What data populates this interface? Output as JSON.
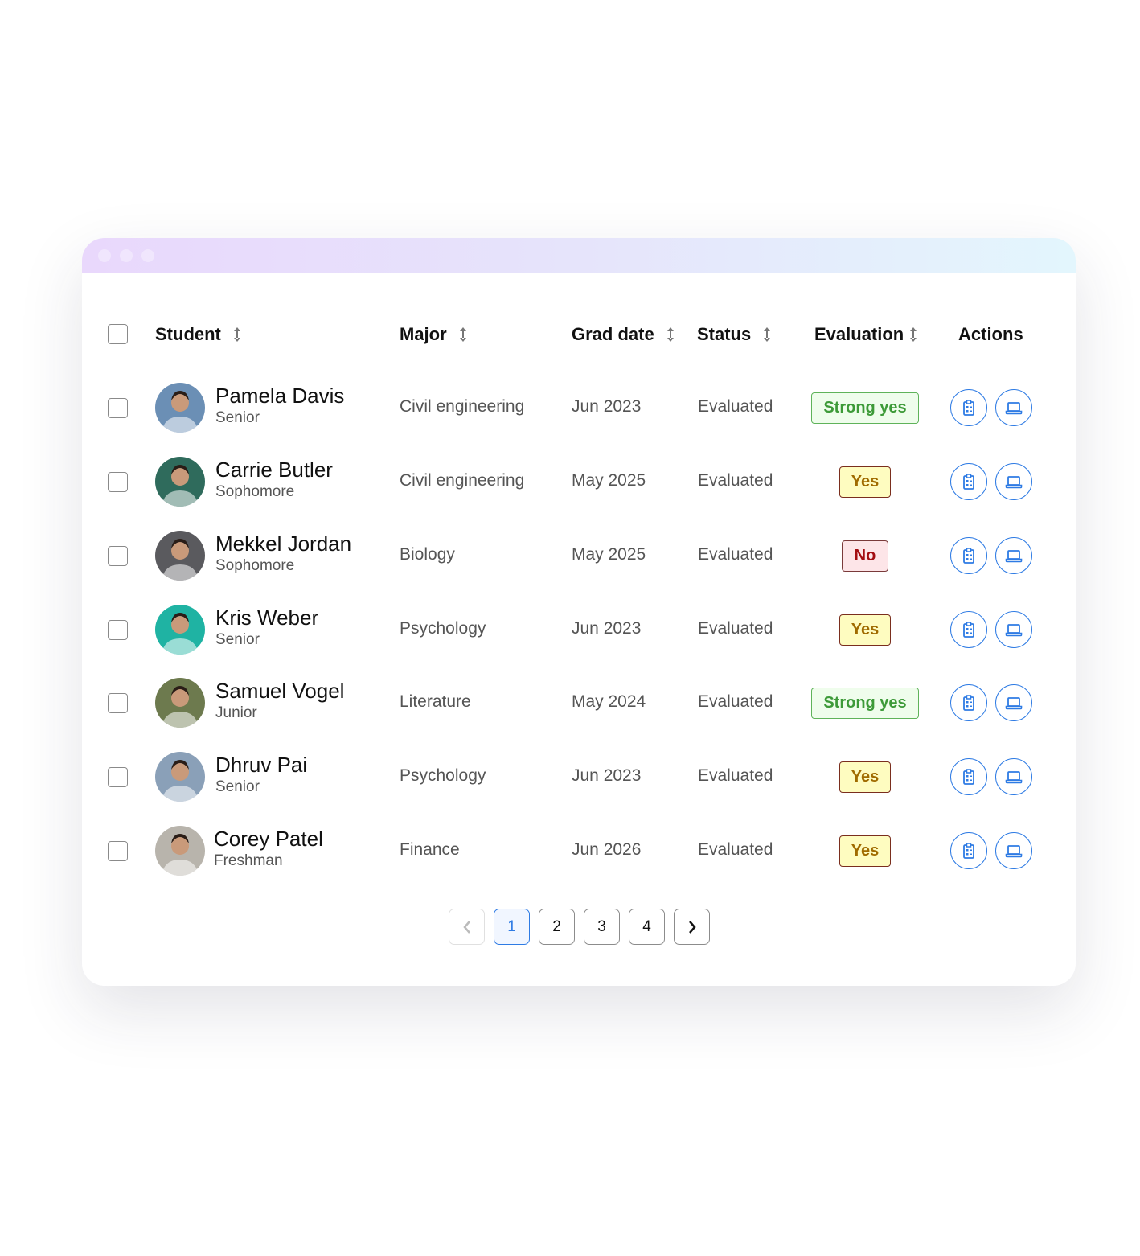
{
  "table": {
    "headers": {
      "student": "Student",
      "major": "Major",
      "grad_date": "Grad date",
      "status": "Status",
      "evaluation": "Evaluation",
      "actions": "Actions"
    },
    "rows": [
      {
        "name": "Pamela Davis",
        "level": "Senior",
        "major": "Civil engineering",
        "grad": "Jun 2023",
        "status": "Evaluated",
        "evaluation": "Strong yes",
        "eval_type": "strong",
        "avatar_color": "#6b8fb5"
      },
      {
        "name": "Carrie Butler",
        "level": "Sophomore",
        "major": "Civil engineering",
        "grad": "May 2025",
        "status": "Evaluated",
        "evaluation": "Yes",
        "eval_type": "yes",
        "avatar_color": "#2f6b5c"
      },
      {
        "name": "Mekkel Jordan",
        "level": "Sophomore",
        "major": "Biology",
        "grad": "May 2025",
        "status": "Evaluated",
        "evaluation": "No",
        "eval_type": "no",
        "avatar_color": "#5a5a5e"
      },
      {
        "name": "Kris Weber",
        "level": "Senior",
        "major": "Psychology",
        "grad": "Jun 2023",
        "status": "Evaluated",
        "evaluation": "Yes",
        "eval_type": "yes",
        "avatar_color": "#1fb3a3"
      },
      {
        "name": "Samuel Vogel",
        "level": "Junior",
        "major": "Literature",
        "grad": "May 2024",
        "status": "Evaluated",
        "evaluation": "Strong yes",
        "eval_type": "strong",
        "avatar_color": "#6d7a4e"
      },
      {
        "name": "Dhruv Pai",
        "level": "Senior",
        "major": "Psychology",
        "grad": "Jun 2023",
        "status": "Evaluated",
        "evaluation": "Yes",
        "eval_type": "yes",
        "avatar_color": "#8aa0b8"
      },
      {
        "name": "Corey Patel",
        "level": "Freshman",
        "major": "Finance",
        "grad": "Jun 2026",
        "status": "Evaluated",
        "evaluation": "Yes",
        "eval_type": "yes",
        "avatar_color": "#b8b4ac"
      }
    ],
    "action_icons": [
      "clipboard-icon",
      "laptop-icon"
    ]
  },
  "pagination": {
    "pages": [
      "1",
      "2",
      "3",
      "4"
    ],
    "current": "1"
  },
  "colors": {
    "accent": "#2e7be4"
  }
}
